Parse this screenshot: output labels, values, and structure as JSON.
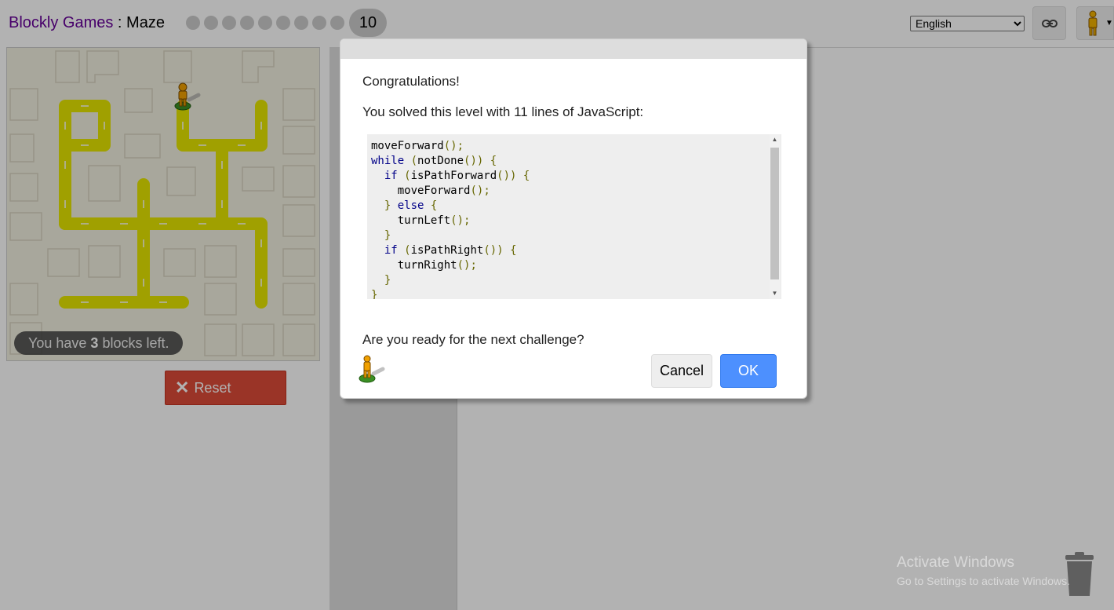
{
  "header": {
    "app_title": "Blockly Games",
    "separator": " : ",
    "game_title": "Maze",
    "current_level": "10",
    "completed_level_count": 9,
    "language": "English",
    "language_options": [
      "English"
    ]
  },
  "maze": {
    "blocks_left_prefix": "You have ",
    "blocks_left_count": "3",
    "blocks_left_suffix": " blocks left.",
    "path_color": "#e5e500",
    "background_color": "#f1efe0"
  },
  "controls": {
    "reset_label": "Reset"
  },
  "dialog": {
    "congrats": "Congratulations!",
    "solved_text": "You solved this level with 11 lines of JavaScript:",
    "code_lines": [
      "moveForward();",
      "while (notDone()) {",
      "  if (isPathForward()) {",
      "    moveForward();",
      "  } else {",
      "    turnLeft();",
      "  }",
      "  if (isPathRight()) {",
      "    turnRight();",
      "  }",
      "}"
    ],
    "next_prompt": "Are you ready for the next challenge?",
    "cancel_label": "Cancel",
    "ok_label": "OK"
  },
  "watermark": {
    "line1": "Activate Windows",
    "line2": "Go to Settings to activate Windows."
  },
  "colors": {
    "accent_blue": "#4d90fe",
    "reset_red": "#dd4b39",
    "title_purple": "#660099"
  }
}
